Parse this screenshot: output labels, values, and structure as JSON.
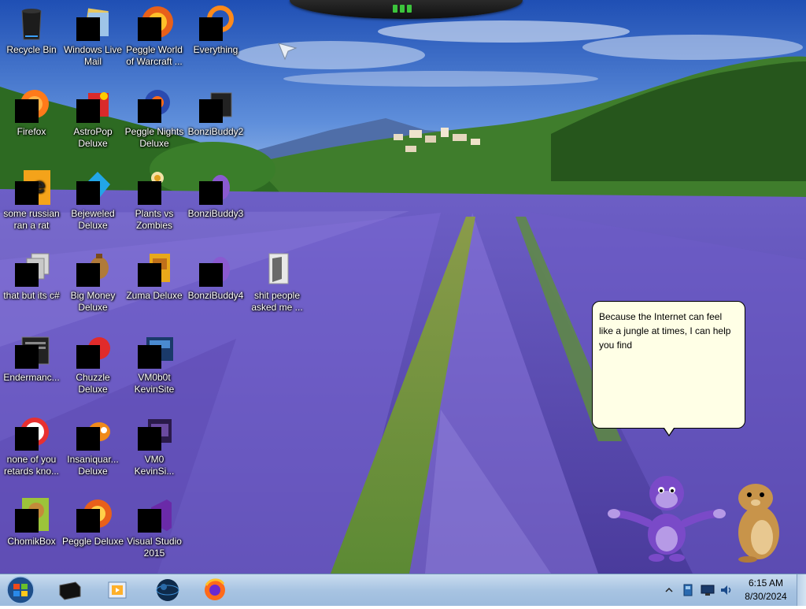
{
  "desktop": {
    "icons": [
      {
        "label": "Recycle Bin",
        "icon": "recycle-bin-icon"
      },
      {
        "label": "Windows Live\nMail",
        "icon": "windows-live-mail-icon"
      },
      {
        "label": "Peggle World\nof Warcraft ...",
        "icon": "peggle-world-of-warcraft-icon"
      },
      {
        "label": "Everything",
        "icon": "everything-search-icon"
      },
      {
        "label": "Firefox",
        "icon": "firefox-icon"
      },
      {
        "label": "AstroPop\nDeluxe",
        "icon": "astropop-icon"
      },
      {
        "label": "Peggle Nights\nDeluxe",
        "icon": "peggle-nights-icon"
      },
      {
        "label": "BonziBuddy2",
        "icon": "bonzibuddy-folder-icon"
      },
      {
        "label": "some russian\nran a rat",
        "icon": "file-icon"
      },
      {
        "label": "Bejeweled\nDeluxe",
        "icon": "bejeweled-icon"
      },
      {
        "label": "Plants vs\nZombies",
        "icon": "plants-vs-zombies-icon"
      },
      {
        "label": "BonziBuddy3",
        "icon": "bonzibuddy-icon"
      },
      {
        "label": "that but its c#",
        "icon": "files-stack-icon"
      },
      {
        "label": "Big Money\nDeluxe",
        "icon": "big-money-icon"
      },
      {
        "label": "Zuma Deluxe",
        "icon": "zuma-icon"
      },
      {
        "label": "BonziBuddy4",
        "icon": "bonzibuddy-icon"
      },
      {
        "label": "shit people\nasked me ...",
        "icon": "folder-icon"
      },
      {
        "label": "Endermanc...",
        "icon": "app-window-icon"
      },
      {
        "label": "Chuzzle\nDeluxe",
        "icon": "chuzzle-icon"
      },
      {
        "label": "VM0b0t\nKevinSite",
        "icon": "vm-icon"
      },
      {
        "label": "none of you\nretards kno...",
        "icon": "app-icon"
      },
      {
        "label": "Insaniquar...\nDeluxe",
        "icon": "insaniquarium-icon"
      },
      {
        "label": "VM0\nKevinSi...",
        "icon": "vm-icon"
      },
      {
        "label": "ChomikBox",
        "icon": "chomikbox-icon"
      },
      {
        "label": "Peggle Deluxe",
        "icon": "peggle-deluxe-icon"
      },
      {
        "label": "Visual Studio\n2015",
        "icon": "visual-studio-icon"
      }
    ]
  },
  "speech_bubble": {
    "text": "Because the Internet can feel like a jungle at times, I can help you find"
  },
  "taskbar": {
    "start": "windows-start-icon",
    "pinned": [
      "media-player-icon",
      "slideshow-icon",
      "globe-browser-icon",
      "firefox-icon"
    ],
    "tray_icons": [
      "show-hidden-icons-chevron",
      "network-device-icon",
      "monitor-icon",
      "volume-icon"
    ],
    "time": "6:15 AM",
    "date": "8/30/2024"
  }
}
